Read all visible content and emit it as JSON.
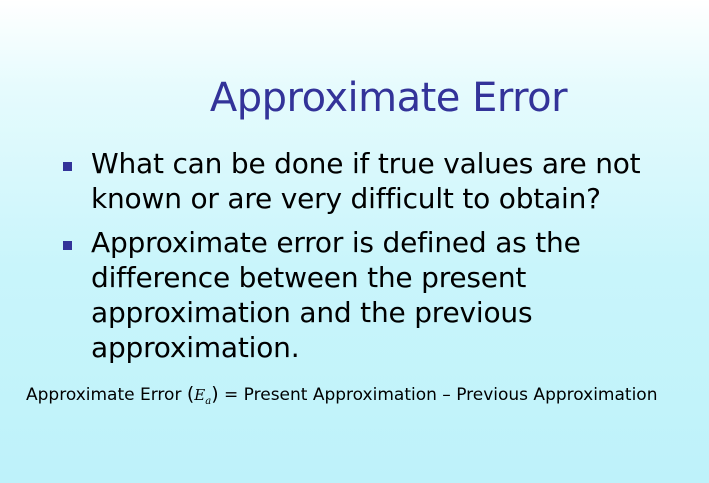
{
  "slide": {
    "title": "Approximate Error",
    "bullets": [
      "What can be done if true values are not known or are very difficult to obtain?",
      "Approximate error is defined as the difference between the present approximation and the previous approximation."
    ],
    "formula": {
      "lhs": "Approximate Error",
      "symbol": "E",
      "symbol_subscript": "a",
      "rhs": "= Present Approximation – Previous Approximation"
    }
  },
  "colors": {
    "title": "#333399",
    "bullet_marker": "#333399",
    "background_top": "#ffffff",
    "background_bottom": "#bef2fa"
  }
}
